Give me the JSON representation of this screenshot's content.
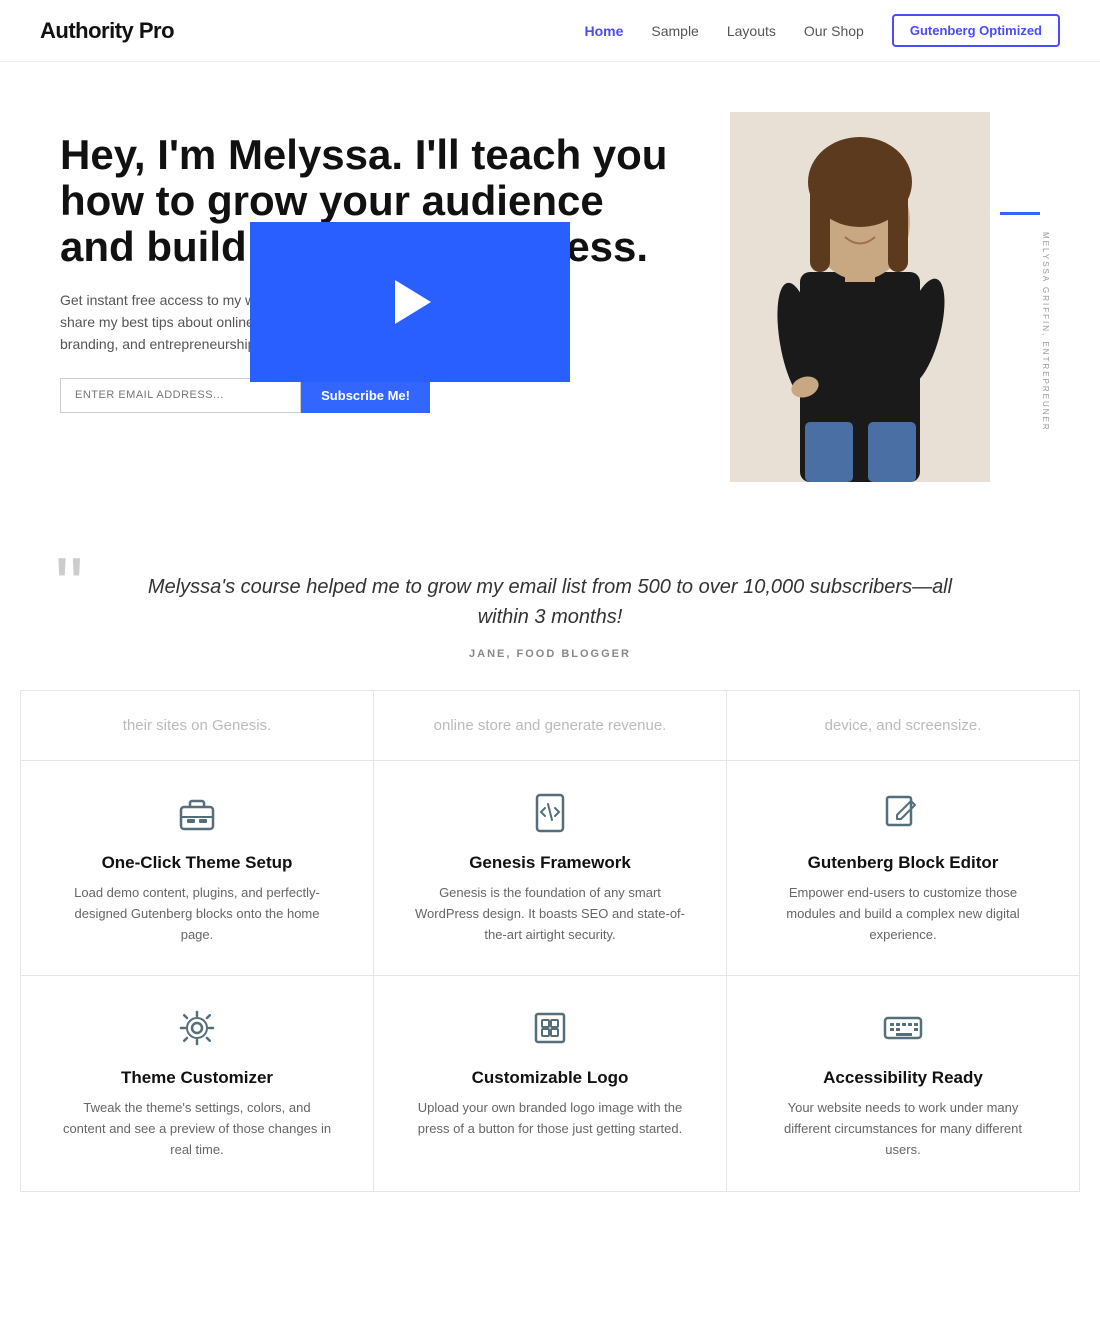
{
  "header": {
    "site_title": "Authority Pro",
    "nav_links": [
      {
        "label": "Home",
        "active": true
      },
      {
        "label": "Sample",
        "active": false
      },
      {
        "label": "Layouts",
        "active": false
      },
      {
        "label": "Our Shop",
        "active": false
      }
    ],
    "nav_button": "Gutenberg Optimized"
  },
  "hero": {
    "title": "Hey, I'm Melyssa. I'll teach you how to grow your audience and build an online business.",
    "description": "Get instant free access to my weekly newsletter where I share my best tips about online marketing, personal branding, and entrepreneurship.",
    "email_placeholder": "ENTER EMAIL ADDRESS...",
    "subscribe_label": "Subscribe Me!",
    "person_caption": "MELYSSA GRIFFIN, ENTREPREUNER"
  },
  "testimonial": {
    "quote": "Melyssa's course helped me to grow my email list from 500 to over 10,000 subscribers—all within 3 months!",
    "author": "JANE, FOOD BLOGGER"
  },
  "features_row1": [
    {
      "partial_text": "their sites on Genesis."
    },
    {
      "partial_text": "online store and generate revenue."
    },
    {
      "partial_text": "device, and screensize."
    }
  ],
  "features_row2": [
    {
      "icon": "briefcase",
      "title": "One-Click Theme Setup",
      "desc": "Load demo content, plugins, and perfectly-designed Gutenberg blocks onto the home page."
    },
    {
      "icon": "code-file",
      "title": "Genesis Framework",
      "desc": "Genesis is the foundation of any smart WordPress design. It boasts SEO and state-of-the-art airtight security."
    },
    {
      "icon": "edit",
      "title": "Gutenberg Block Editor",
      "desc": "Empower end-users to customize those modules and build a complex new digital experience."
    }
  ],
  "features_row3": [
    {
      "icon": "gear",
      "title": "Theme Customizer",
      "desc": "Tweak the theme's settings, colors, and content and see a preview of those changes in real time."
    },
    {
      "icon": "logo",
      "title": "Customizable Logo",
      "desc": "Upload your own branded logo image with the press of a button for those just getting started."
    },
    {
      "icon": "keyboard",
      "title": "Accessibility Ready",
      "desc": "Your website needs to work under many different circumstances for many different users."
    }
  ]
}
